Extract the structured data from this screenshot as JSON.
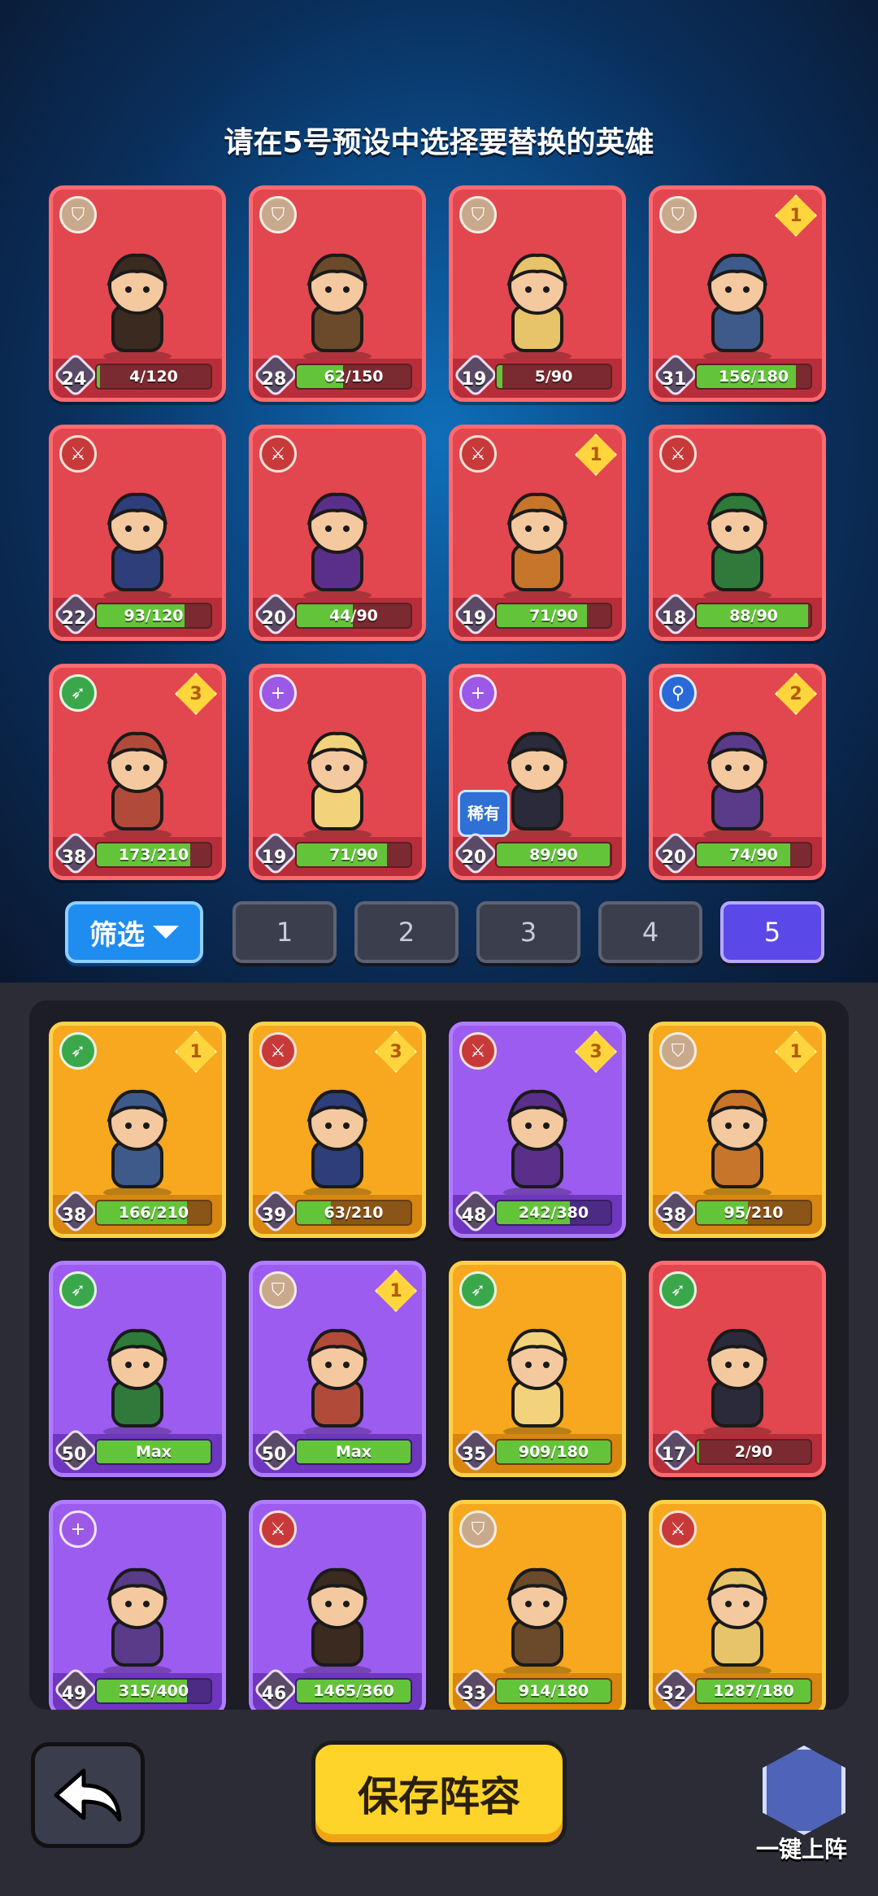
{
  "instruction": "请在5号预设中选择要替换的英雄",
  "preset_heroes": [
    {
      "level": "24",
      "progress": "4/120",
      "fill": 0.03,
      "role": "tank",
      "stars": "",
      "bg": "red"
    },
    {
      "level": "28",
      "progress": "62/150",
      "fill": 0.41,
      "role": "tank",
      "stars": "",
      "bg": "red"
    },
    {
      "level": "19",
      "progress": "5/90",
      "fill": 0.05,
      "role": "tank",
      "stars": "",
      "bg": "red"
    },
    {
      "level": "31",
      "progress": "156/180",
      "fill": 0.87,
      "role": "tank",
      "stars": "1",
      "bg": "red"
    },
    {
      "level": "22",
      "progress": "93/120",
      "fill": 0.77,
      "role": "warrior",
      "stars": "",
      "bg": "red"
    },
    {
      "level": "20",
      "progress": "44/90",
      "fill": 0.49,
      "role": "warrior",
      "stars": "",
      "bg": "red"
    },
    {
      "level": "19",
      "progress": "71/90",
      "fill": 0.79,
      "role": "warrior",
      "stars": "1",
      "bg": "red"
    },
    {
      "level": "18",
      "progress": "88/90",
      "fill": 0.98,
      "role": "warrior",
      "stars": "",
      "bg": "red"
    },
    {
      "level": "38",
      "progress": "173/210",
      "fill": 0.82,
      "role": "archer",
      "stars": "3",
      "bg": "red"
    },
    {
      "level": "19",
      "progress": "71/90",
      "fill": 0.79,
      "role": "support",
      "stars": "",
      "bg": "red"
    },
    {
      "level": "20",
      "progress": "89/90",
      "fill": 0.99,
      "role": "support",
      "stars": "",
      "bg": "red",
      "badge": "稀有"
    },
    {
      "level": "20",
      "progress": "74/90",
      "fill": 0.82,
      "role": "mage",
      "stars": "2",
      "bg": "red"
    }
  ],
  "filter_label": "筛选",
  "presets": [
    "1",
    "2",
    "3",
    "4",
    "5"
  ],
  "active_preset": "5",
  "roster_heroes": [
    {
      "level": "38",
      "progress": "166/210",
      "fill": 0.79,
      "role": "archer",
      "stars": "1",
      "bg": "orange"
    },
    {
      "level": "39",
      "progress": "63/210",
      "fill": 0.3,
      "role": "warrior",
      "stars": "3",
      "bg": "orange"
    },
    {
      "level": "48",
      "progress": "242/380",
      "fill": 0.64,
      "role": "warrior",
      "stars": "3",
      "bg": "purple"
    },
    {
      "level": "38",
      "progress": "95/210",
      "fill": 0.45,
      "role": "tank",
      "stars": "1",
      "bg": "orange"
    },
    {
      "level": "50",
      "progress": "Max",
      "fill": 1.0,
      "role": "archer",
      "stars": "",
      "bg": "purple"
    },
    {
      "level": "50",
      "progress": "Max",
      "fill": 1.0,
      "role": "tank",
      "stars": "1",
      "bg": "purple"
    },
    {
      "level": "35",
      "progress": "909/180",
      "fill": 1.0,
      "role": "archer",
      "stars": "",
      "bg": "orange"
    },
    {
      "level": "17",
      "progress": "2/90",
      "fill": 0.02,
      "role": "archer",
      "stars": "",
      "bg": "red"
    },
    {
      "level": "49",
      "progress": "315/400",
      "fill": 0.79,
      "role": "support",
      "stars": "",
      "bg": "purple"
    },
    {
      "level": "46",
      "progress": "1465/360",
      "fill": 1.0,
      "role": "warrior",
      "stars": "",
      "bg": "purple"
    },
    {
      "level": "33",
      "progress": "914/180",
      "fill": 1.0,
      "role": "tank",
      "stars": "",
      "bg": "orange"
    },
    {
      "level": "32",
      "progress": "1287/180",
      "fill": 1.0,
      "role": "warrior",
      "stars": "",
      "bg": "orange"
    }
  ],
  "save_label": "保存阵容",
  "auto_label": "一键上阵",
  "icons": {
    "back": "back-arrow-icon",
    "auto": "auto-deploy-icon",
    "filter": "dropdown-triangle-icon"
  },
  "colors": {
    "bar_fill": "#63c43a",
    "active_preset": "#5b48e8",
    "save_button": "#ffd42a",
    "filter_button": "#1f8cf0"
  }
}
